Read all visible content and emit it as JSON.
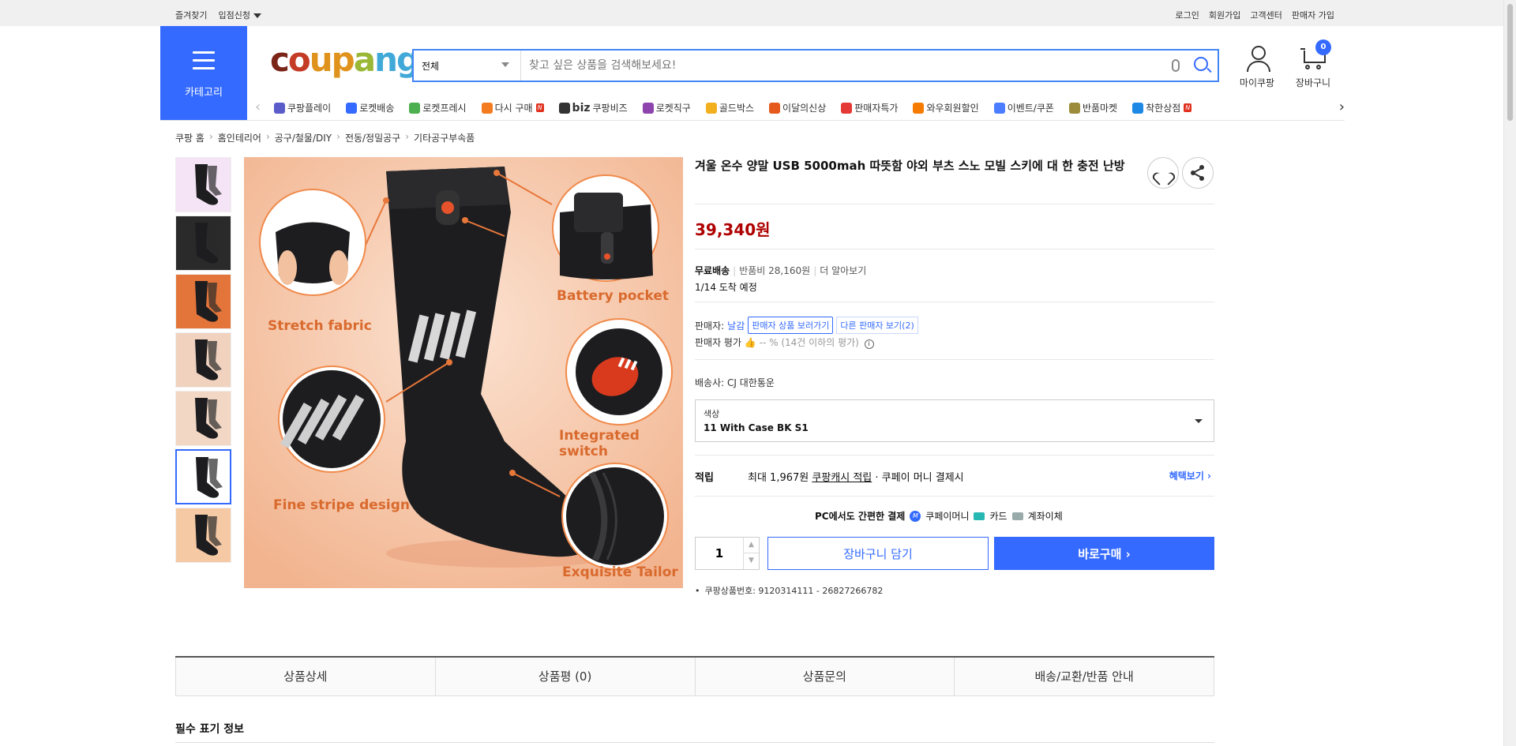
{
  "topbar": {
    "left": [
      "즐겨찾기",
      "입점신청"
    ],
    "right": [
      "로그인",
      "회원가입",
      "고객센터",
      "판매자 가입"
    ]
  },
  "header": {
    "category_label": "카테고리",
    "logo_text": "coupang",
    "search": {
      "category": "전체",
      "placeholder": "찾고 싶은 상품을 검색해보세요!"
    },
    "mypage_label": "마이쿠팡",
    "cart_label": "장바구니",
    "cart_count": "0"
  },
  "nav": [
    {
      "label": "쿠팡플레이",
      "icon": "play-icon",
      "color": "#5a5cc9"
    },
    {
      "label": "로켓배송",
      "icon": "rocket-icon",
      "color": "#346aff"
    },
    {
      "label": "로켓프레시",
      "icon": "rocket-fresh-icon",
      "color": "#4caf50"
    },
    {
      "label": "다시 구매",
      "icon": "rebuy-icon",
      "color": "#f47b20",
      "badge": "N"
    },
    {
      "label": "쿠팡비즈",
      "prefix": "biz",
      "icon": "biz-icon",
      "color": "#333333"
    },
    {
      "label": "로켓직구",
      "icon": "rocket-global-icon",
      "color": "#8e44ad"
    },
    {
      "label": "골드박스",
      "icon": "goldbox-icon",
      "color": "#f2b01e"
    },
    {
      "label": "이달의신상",
      "icon": "new-icon",
      "color": "#e55a1c"
    },
    {
      "label": "판매자특가",
      "icon": "seller-deal-icon",
      "color": "#e53935"
    },
    {
      "label": "와우회원할인",
      "icon": "wow-icon",
      "color": "#f57c00"
    },
    {
      "label": "이벤트/쿠폰",
      "icon": "coupon-icon",
      "color": "#4a7dff"
    },
    {
      "label": "반품마켓",
      "icon": "return-market-icon",
      "color": "#9c8b3a"
    },
    {
      "label": "착한상점",
      "icon": "good-store-icon",
      "color": "#1e88e5",
      "badge": "N"
    }
  ],
  "breadcrumb": [
    "쿠팡 홈",
    "홈인테리어",
    "공구/철물/DIY",
    "전동/정밀공구",
    "기타공구부속품"
  ],
  "product": {
    "title": "겨울 온수 양말 USB 5000mah 따뜻함 야외 부츠 스노 모빌 스키에 대 한 충전 난방",
    "price": "39,340원",
    "shipping": {
      "free": "무료배송",
      "return_fee": "반품비 28,160원",
      "more": "더 알아보기",
      "arrival": "1/14 도착 예정"
    },
    "seller": {
      "label": "판매자:",
      "name": "날감",
      "view_products": "판매자 상품 보러가기",
      "other_sellers": "다른 판매자 보기(2)",
      "rating_label": "판매자 평가",
      "rating_value": "-- %",
      "rating_note": "(14건 이하의 평가)"
    },
    "carrier_label": "배송사:",
    "carrier": "CJ 대한통운",
    "option": {
      "label": "색상",
      "value": "11 With Case BK S1"
    },
    "reward": {
      "label": "적립",
      "prefix": "최대 1,967원",
      "cash": "쿠팡캐시 적립",
      "suffix": "· 쿠페이 머니 결제시",
      "link": "혜택보기"
    },
    "payment": {
      "title": "PC에서도 간편한 결제",
      "methods": [
        "쿠페이머니",
        "카드",
        "계좌이체"
      ]
    },
    "quantity": "1",
    "add_cart": "장바구니 담기",
    "buy_now": "바로구매",
    "product_code": "쿠팡상품번호: 9120314111 - 26827266782"
  },
  "image_annotations": [
    "Stretch fabric",
    "Battery pocket",
    "Integrated switch",
    "Fine stripe design",
    "Exquisite Tailor"
  ],
  "thumbnails": 7,
  "selected_thumbnail": 6,
  "tabs": [
    "상품상세",
    "상품평 (0)",
    "상품문의",
    "배송/교환/반품 안내"
  ],
  "required_info": "필수 표기 정보",
  "colors": {
    "accent": "#346aff",
    "price": "#ae0000",
    "image_bg": "#f5c5a6"
  }
}
